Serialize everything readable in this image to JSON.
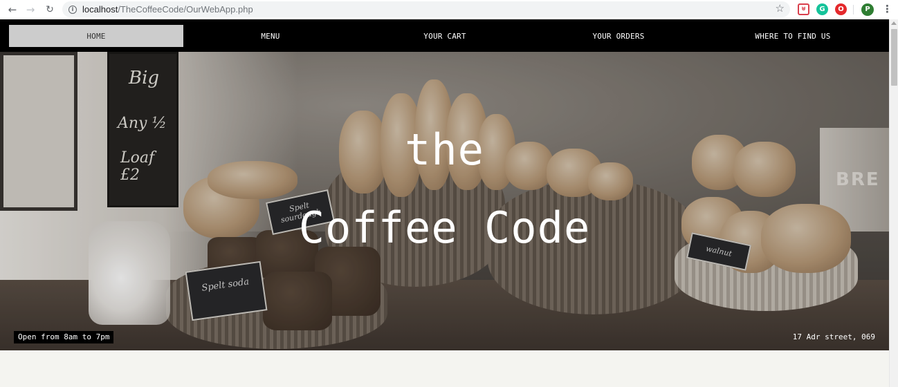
{
  "browser": {
    "url_host": "localhost",
    "url_path": "/TheCoffeeCode/OurWebApp.php",
    "profile_initial": "P"
  },
  "nav": {
    "items": [
      {
        "label": "HOME",
        "active": true
      },
      {
        "label": "MENU",
        "active": false
      },
      {
        "label": "YOUR CART",
        "active": false
      },
      {
        "label": "YOUR ORDERS",
        "active": false
      },
      {
        "label": "WHERE TO FIND US",
        "active": false
      }
    ]
  },
  "hero": {
    "title_top": "the",
    "title_main": "Coffee Code",
    "hours": "Open from 8am to 7pm",
    "address": "17 Adr street, 069"
  },
  "photo_text": {
    "chalk_1": "Big",
    "chalk_2": "Any ½",
    "chalk_3": "Loaf £2",
    "sign_1": "Spelt sourdough",
    "sign_2": "Spelt soda",
    "sign_3": "walnut",
    "tin": "BRE"
  },
  "colors": {
    "nav_bg": "#000000",
    "nav_active": "#cccccc",
    "page_bg": "#f4f4f0"
  }
}
